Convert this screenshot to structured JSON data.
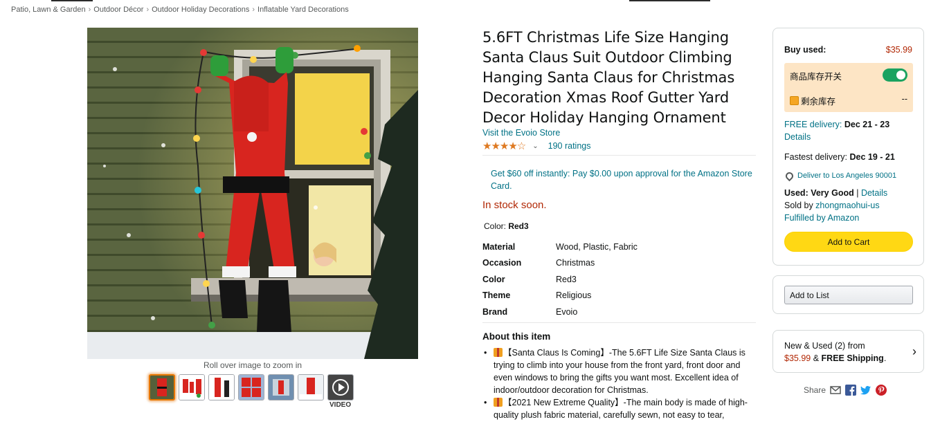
{
  "breadcrumb": {
    "items": [
      "Patio, Lawn & Garden",
      "Outdoor Décor",
      "Outdoor Holiday Decorations",
      "Inflatable Yard Decorations"
    ],
    "separator": "›"
  },
  "gallery": {
    "zoom_hint": "Roll over image to zoom in",
    "video_label": "VIDEO",
    "thumbnail_count": 7
  },
  "product": {
    "title": "5.6FT Christmas Life Size Hanging Santa Claus Suit Outdoor Climbing Hanging Santa Claus for Christmas Decoration Xmas Roof Gutter Yard Decor Holiday Hanging Ornament",
    "store_link": "Visit the Evoio Store",
    "rating_stars": "★★★★☆",
    "ratings_count": "190 ratings",
    "promo": "Get $60 off instantly: Pay $0.00 upon approval for the Amazon Store Card.",
    "stock": "In stock soon.",
    "color_label": "Color: ",
    "color_value": "Red3",
    "specs": [
      {
        "key": "Material",
        "value": "Wood, Plastic, Fabric"
      },
      {
        "key": "Occasion",
        "value": "Christmas"
      },
      {
        "key": "Color",
        "value": "Red3"
      },
      {
        "key": "Theme",
        "value": "Religious"
      },
      {
        "key": "Brand",
        "value": "Evoio"
      }
    ],
    "about_title": "About this item",
    "bullets": [
      "【Santa Claus Is Coming】-The 5.6FT Life Size Santa Claus is trying to climb into your house from the front yard, front door and even windows to bring the gifts you want most. Excellent idea of indoor/outdoor decoration for Christmas.",
      "【2021 New Extreme Quality】-The main body is made of high-quality plush fabric material, carefully sewn, not easy to tear,"
    ]
  },
  "buybox": {
    "buy_used_label": "Buy used:",
    "price": "$35.99",
    "plugin_toggle_label": "商品库存开关",
    "plugin_stock_label": "剩余库存",
    "plugin_stock_value": "--",
    "free_delivery_prefix": "FREE delivery: ",
    "free_delivery_dates": "Dec 21 - 23",
    "details_link": "Details",
    "fastest_prefix": "Fastest delivery: ",
    "fastest_dates": "Dec 19 - 21",
    "deliver_to": "Deliver to Los Angeles 90001",
    "used_condition": "Used: Very Good",
    "used_details_link": "Details",
    "sold_by_prefix": "Sold by ",
    "seller": "zhongmaohui-us",
    "fulfilled": "Fulfilled by Amazon",
    "add_to_cart": "Add to Cart"
  },
  "listbox": {
    "add_to_list": "Add to List"
  },
  "new_used": {
    "line1": "New & Used (2) from",
    "price": "$35.99",
    "amp": " & ",
    "shipping": "FREE Shipping",
    "period": "."
  },
  "share": {
    "label": "Share"
  },
  "colors": {
    "link": "#007185",
    "price": "#b12704",
    "cart_button": "#ffd814",
    "star": "#de7921",
    "toggle_on": "#1aa260",
    "plugin_bg": "#fde5c5"
  }
}
